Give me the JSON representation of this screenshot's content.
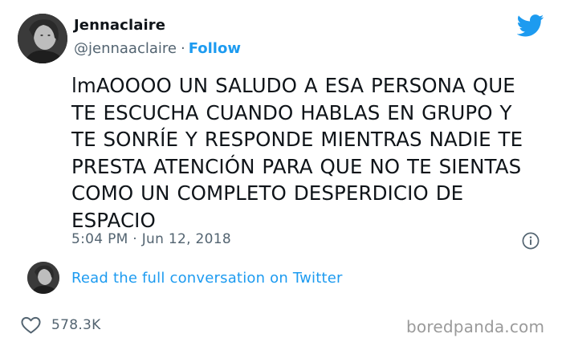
{
  "author": {
    "name": "Jennaclaire",
    "handle": "@jennaaclaire",
    "separator": "·",
    "follow_label": "Follow"
  },
  "tweet": {
    "text": "lmAOOOO UN SALUDO A ESA PERSONA QUE\nTE ESCUCHA CUANDO HABLAS EN GRUPO Y\nTE SONRÍE Y RESPONDE MIENTRAS NADIE TE\nPRESTA ATENCIÓN PARA QUE NO TE SIENTAS\nCOMO UN COMPLETO DESPERDICIO DE\nESPACIO",
    "timestamp": "5:04 PM · Jun 12, 2018"
  },
  "conversation": {
    "link_label": "Read the full conversation on Twitter"
  },
  "engagement": {
    "likes": "578.3K"
  },
  "watermark": {
    "text": "boredpanda.com"
  },
  "icons": {
    "brand": "twitter-bird-icon",
    "info": "info-icon",
    "like": "heart-icon"
  },
  "colors": {
    "accent": "#1d9bf0",
    "text_primary": "#0f1419",
    "text_secondary": "#536471",
    "watermark": "#9a9a9a"
  }
}
